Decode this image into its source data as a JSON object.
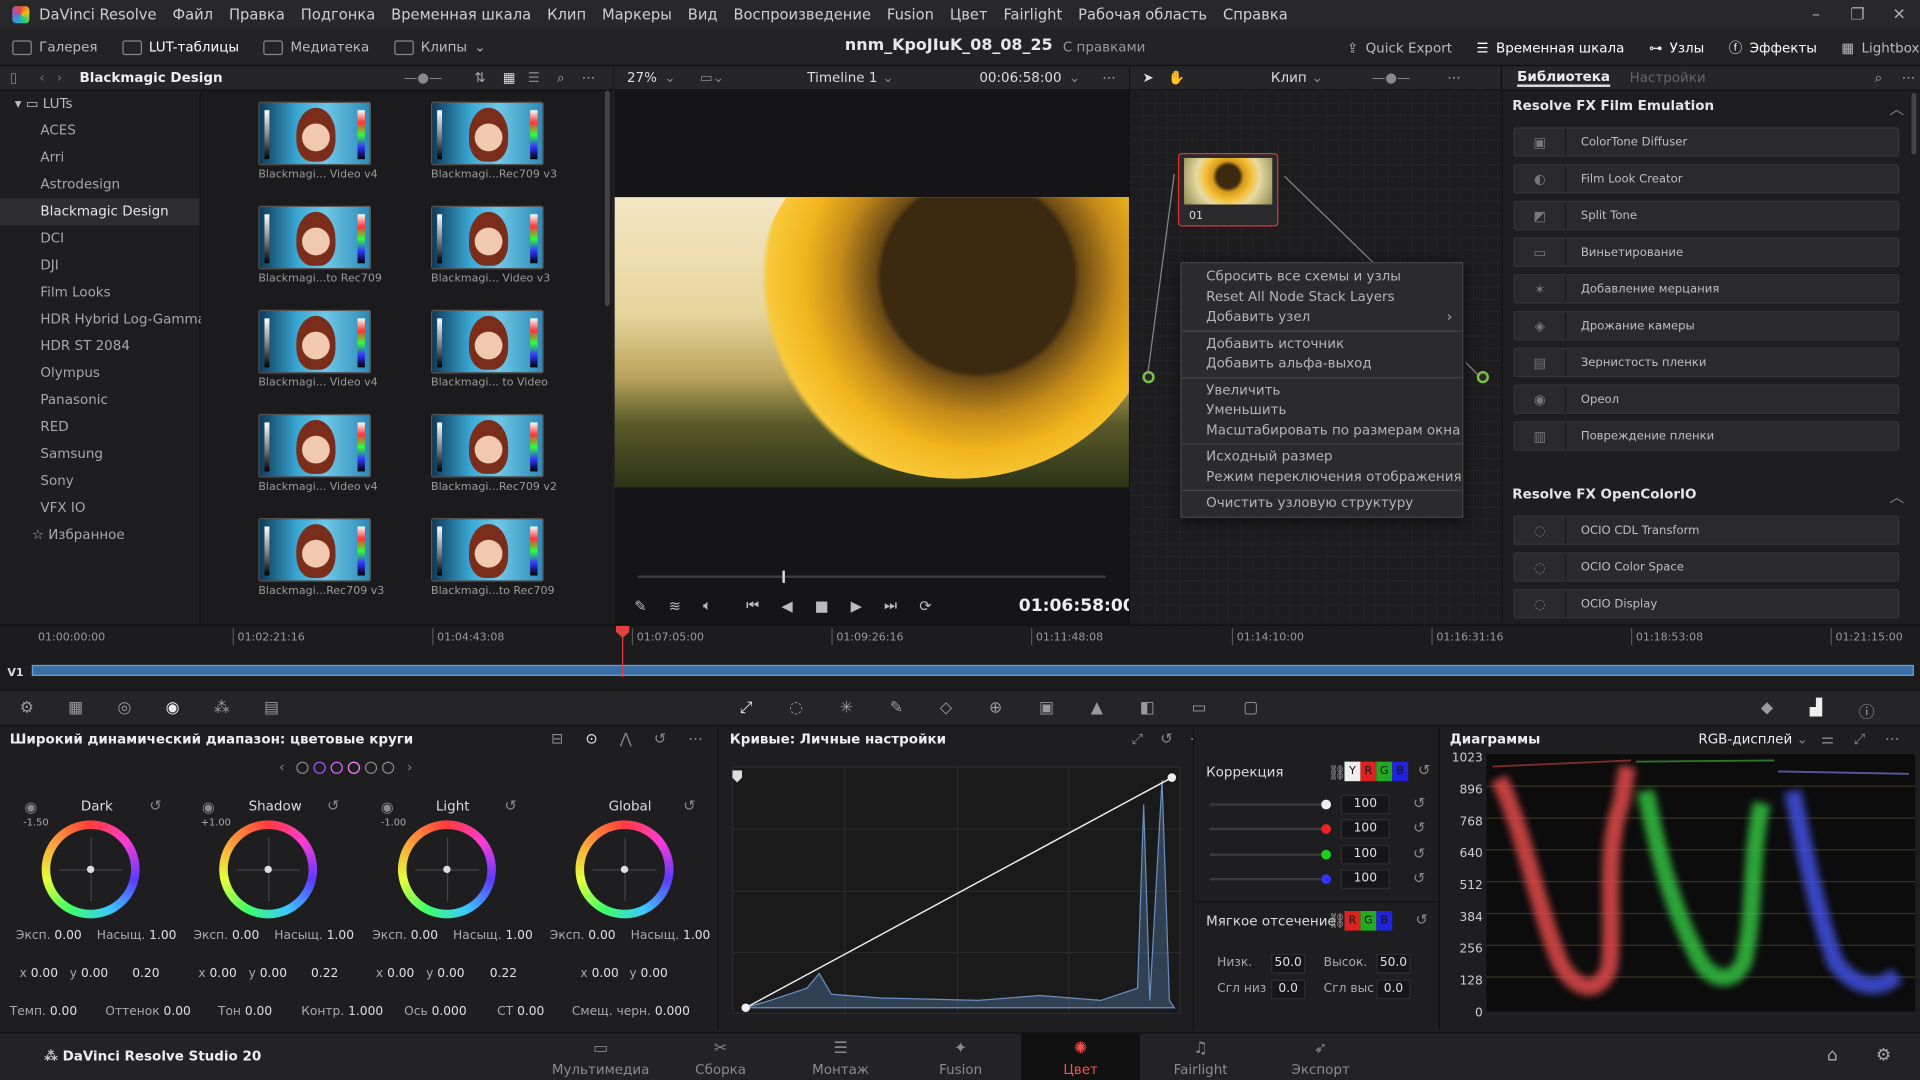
{
  "menubar": {
    "app": "DaVinci Resolve",
    "items": [
      "Файл",
      "Правка",
      "Подгонка",
      "Временная шкала",
      "Клип",
      "Маркеры",
      "Вид",
      "Воспроизведение",
      "Fusion",
      "Цвет",
      "Fairlight",
      "Рабочая область",
      "Справка"
    ]
  },
  "toolbar": {
    "gallery": "Галерея",
    "luts": "LUT-таблицы",
    "media": "Медиатека",
    "clips": "Клипы",
    "project": "nnm_KpoJIuK_08_08_25",
    "project_status": "С правками",
    "quick_export": "Quick Export",
    "timeline": "Временная шкала",
    "nodes": "Узлы",
    "effects": "Эффекты",
    "lightbox": "Lightbox"
  },
  "lutpanel": {
    "title": "Blackmagic Design",
    "root": "LUTs",
    "folders": [
      "ACES",
      "Arri",
      "Astrodesign",
      "Blackmagic Design",
      "DCI",
      "DJI",
      "Film Looks",
      "HDR Hybrid Log-Gamma",
      "HDR ST 2084",
      "Olympus",
      "Panasonic",
      "RED",
      "Samsung",
      "Sony",
      "VFX IO"
    ],
    "favorites": "Избранное",
    "selected": "Blackmagic Design"
  },
  "thumbs": [
    "Blackmagi... Video v4",
    "Blackmagi...Rec709 v3",
    "Blackmagi...to Rec709",
    "Blackmagi... Video v3",
    "Blackmagi... Video v4",
    "Blackmagi... to Video",
    "Blackmagi... Video v4",
    "Blackmagi...Rec709 v2",
    "Blackmagi...Rec709 v3",
    "Blackmagi...to Rec709"
  ],
  "viewer": {
    "zoom": "27%",
    "timeline_name": "Timeline 1",
    "duration": "00:06:58:00",
    "timecode": "01:06:58:00"
  },
  "nodes": {
    "mode": "Клип",
    "node_label": "01"
  },
  "context_menu": {
    "groups": [
      [
        "Сбросить все схемы и узлы",
        "Reset All Node Stack Layers",
        "Добавить узел"
      ],
      [
        "Добавить источник",
        "Добавить альфа-выход"
      ],
      [
        "Увеличить",
        "Уменьшить",
        "Масштабировать по размерам окна"
      ],
      [
        "Исходный размер",
        "Режим переключения отображения"
      ],
      [
        "Очистить узловую структуру"
      ]
    ]
  },
  "effects": {
    "tab_library": "Библиотека",
    "tab_settings": "Настройки",
    "section1": "Resolve FX Film Emulation",
    "items1": [
      "ColorTone Diffuser",
      "Film Look Creator",
      "Split Tone",
      "Виньетирование",
      "Добавление мерцания",
      "Дрожание камеры",
      "Зернистость пленки",
      "Ореол",
      "Повреждение пленки"
    ],
    "section2": "Resolve FX OpenColorIO",
    "items2": [
      "OCIO CDL Transform",
      "OCIO Color Space",
      "OCIO Display"
    ]
  },
  "timeline": {
    "timecodes": [
      "01:00:00:00",
      "01:02:21:16",
      "01:04:43:08",
      "01:07:05:00",
      "01:09:26:16",
      "01:11:48:08",
      "01:14:10:00",
      "01:16:31:16",
      "01:18:53:08",
      "01:21:15:00"
    ],
    "track": "V1"
  },
  "wheels": {
    "title": "Широкий динамический диапазон: цветовые круги",
    "items": [
      {
        "name": "Dark",
        "zone": "-1.50",
        "exp": "0.00",
        "sat": "1.00",
        "x": "0.00",
        "y": "0.00",
        "z": "0.20"
      },
      {
        "name": "Shadow",
        "zone": "+1.00",
        "exp": "0.00",
        "sat": "1.00",
        "x": "0.00",
        "y": "0.00",
        "z": "0.22"
      },
      {
        "name": "Light",
        "zone": "-1.00",
        "exp": "0.00",
        "sat": "1.00",
        "x": "0.00",
        "y": "0.00",
        "z": "0.22"
      },
      {
        "name": "Global",
        "zone": "",
        "exp": "0.00",
        "sat": "1.00",
        "x": "0.00",
        "y": "0.00",
        "z": ""
      }
    ],
    "exp_label": "Эксп.",
    "sat_label": "Насыщ.",
    "bottom": [
      {
        "label": "Темп.",
        "value": "0.00"
      },
      {
        "label": "Оттенок",
        "value": "0.00"
      },
      {
        "label": "Тон",
        "value": "0.00"
      },
      {
        "label": "Контр.",
        "value": "1.000"
      },
      {
        "label": "Ось",
        "value": "0.000"
      },
      {
        "label": "СТ",
        "value": "0.00"
      },
      {
        "label": "Смещ. черн.",
        "value": "0.000"
      }
    ]
  },
  "curves": {
    "title": "Кривые: Личные настройки"
  },
  "correction": {
    "title": "Коррекция",
    "values": [
      "100",
      "100",
      "100",
      "100"
    ],
    "soft": "Мягкое отсечение",
    "low": "Низк.",
    "low_v": "50.0",
    "high": "Высок.",
    "high_v": "50.0",
    "sl": "Сгл низ",
    "sl_v": "0.0",
    "sh": "Сгл выс",
    "sh_v": "0.0",
    "ch_y": "Y",
    "ch_r": "R",
    "ch_g": "G",
    "ch_b": "B"
  },
  "scopes": {
    "title": "Диаграммы",
    "mode": "RGB-дисплей",
    "scale": [
      "1023",
      "896",
      "768",
      "640",
      "512",
      "384",
      "256",
      "128",
      "0"
    ]
  },
  "pagebar": {
    "product": "DaVinci Resolve Studio 20",
    "pages": [
      "Мультимедиа",
      "Сборка",
      "Монтаж",
      "Fusion",
      "Цвет",
      "Fairlight",
      "Экспорт"
    ],
    "active": "Цвет"
  }
}
